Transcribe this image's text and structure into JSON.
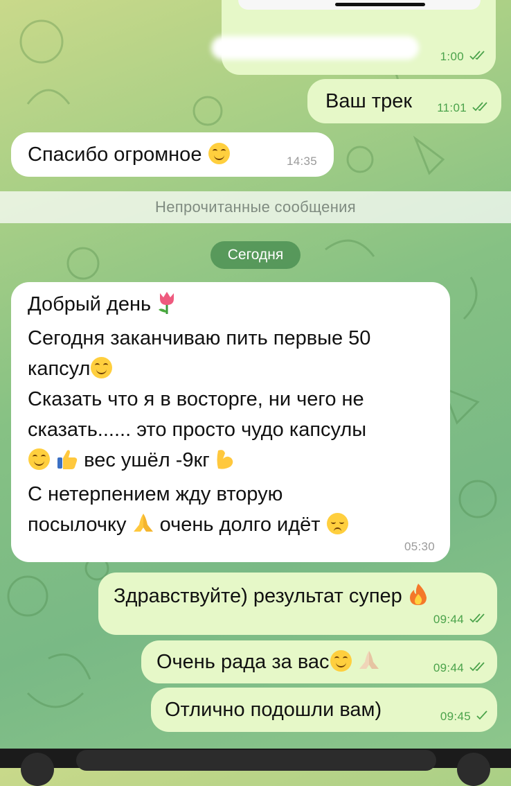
{
  "colors": {
    "outgoing_bubble": "#e6f8c8",
    "incoming_bubble": "#ffffff",
    "outgoing_time": "#4aa24a",
    "separator_text": "#7f8b80"
  },
  "messages": {
    "m0": {
      "time": "1:00"
    },
    "m1": {
      "text": "Ваш трек",
      "time": "11:01"
    },
    "m2": {
      "text": "Спасибо огромное",
      "time": "14:35"
    },
    "unread_separator": "Непрочитанные сообщения",
    "date_pill": "Сегодня",
    "m3": {
      "line1": "Добрый день",
      "line2": "Сегодня заканчиваю пить первые 50",
      "line3": "капсул",
      "line4": "Сказать что я в восторге, ни чего не",
      "line5": "сказать...... это просто чудо капсулы",
      "line6": "вес ушёл -9кг",
      "line7": "С нетерпением жду вторую",
      "line8a": "посылочку",
      "line8b": "очень долго идёт",
      "time": "05:30"
    },
    "m4": {
      "text": "Здравствуйте) результат супер",
      "time": "09:44"
    },
    "m5": {
      "text": "Очень рада за вас",
      "time": "09:44"
    },
    "m6": {
      "text": "Отлично подошли вам)",
      "time": "09:45"
    }
  },
  "icons": [
    "smile-emoji",
    "tulip-emoji",
    "thumbs-up-emoji",
    "flexed-biceps-emoji",
    "folded-hands-emoji",
    "pensive-emoji",
    "fire-emoji",
    "double-check-icon",
    "single-check-icon"
  ]
}
